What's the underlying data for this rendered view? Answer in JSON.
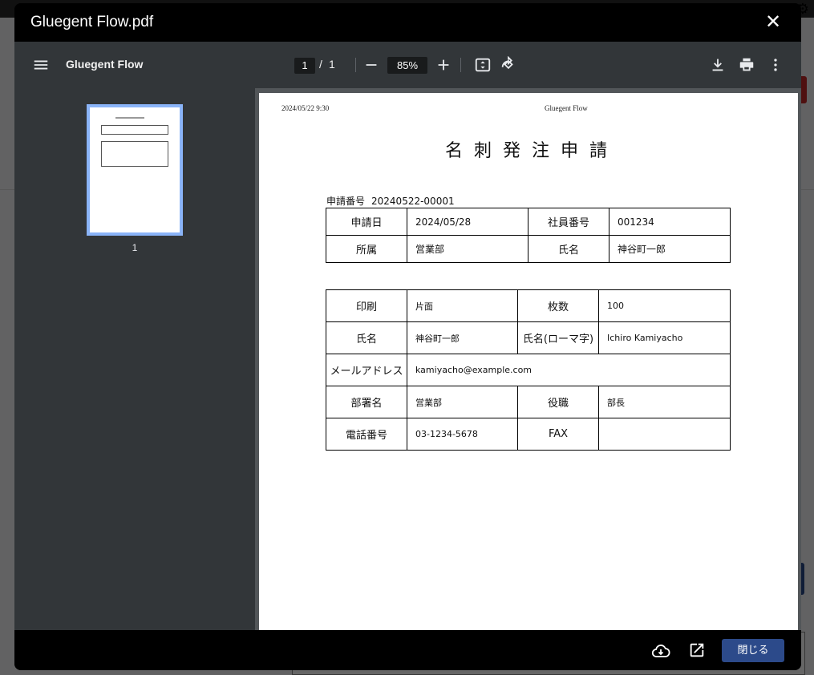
{
  "window": {
    "title": "Gluegent Flow.pdf",
    "close_symbol": "✕"
  },
  "viewer": {
    "doc_name": "Gluegent Flow",
    "current_page": "1",
    "page_separator": "/",
    "total_pages": "1",
    "zoom": "85%",
    "thumbnail_label": "1"
  },
  "document": {
    "header_date": "2024/05/22 9:30",
    "header_app": "Gluegent Flow",
    "title": "名刺発注申請",
    "application_number_label": "申請番号",
    "application_number": "20240522-00001",
    "table1": [
      [
        "申請日",
        "2024/05/28",
        "社員番号",
        "001234"
      ],
      [
        "所属",
        "営業部",
        "氏名",
        "神谷町一郎"
      ]
    ],
    "table2": {
      "print_label": "印刷",
      "print_value": "片面",
      "count_label": "枚数",
      "count_value": "100",
      "name_label": "氏名",
      "name_value": "神谷町一郎",
      "roman_label": "氏名(ローマ字)",
      "roman_value": "Ichiro Kamiyacho",
      "email_label": "メールアドレス",
      "email_value": "kamiyacho@example.com",
      "dept_label": "部署名",
      "dept_value": "営業部",
      "position_label": "役職",
      "position_value": "部長",
      "phone_label": "電話番号",
      "phone_value": "03-1234-5678",
      "fax_label": "FAX",
      "fax_value": ""
    }
  },
  "footer": {
    "close_button": "閉じる"
  },
  "icons": [
    "menu-icon",
    "zoom-out-icon",
    "zoom-in-icon",
    "fit-page-icon",
    "rotate-icon",
    "download-icon",
    "print-icon",
    "more-icon",
    "cloud-download-icon",
    "open-external-icon",
    "close-icon"
  ],
  "colors": {
    "primary_button": "#2c4a8a",
    "thumbnail_border": "#8ab4f8",
    "toolbar_bg": "#323639"
  }
}
